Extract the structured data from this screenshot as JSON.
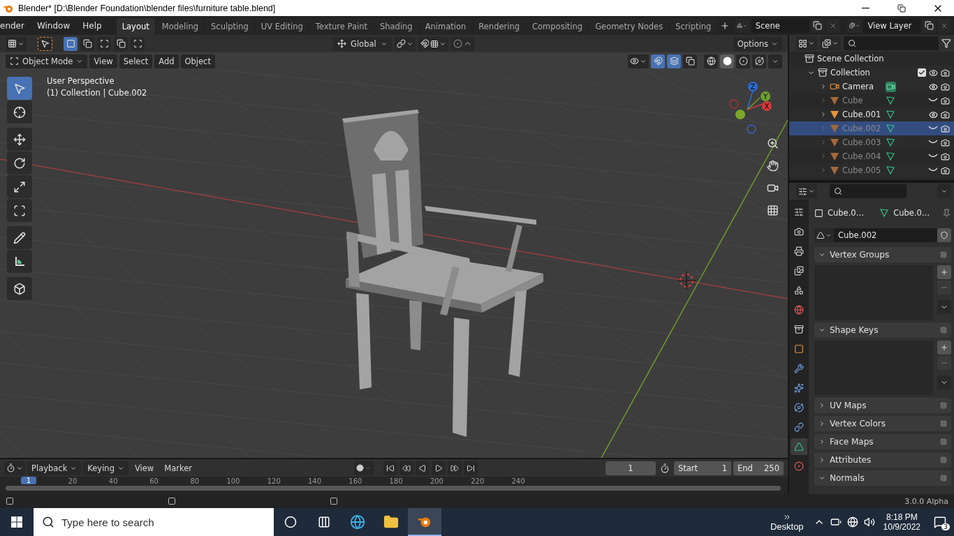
{
  "title_bar": {
    "title": "Blender* [D:\\Blender Foundation\\blender files\\furniture table.blend]"
  },
  "menu": [
    "ender",
    "Window",
    "Help"
  ],
  "workspaces": [
    {
      "label": "Layout",
      "selected": true
    },
    {
      "label": "Modeling",
      "selected": false
    },
    {
      "label": "Sculpting",
      "selected": false
    },
    {
      "label": "UV Editing",
      "selected": false
    },
    {
      "label": "Texture Paint",
      "selected": false
    },
    {
      "label": "Shading",
      "selected": false
    },
    {
      "label": "Animation",
      "selected": false
    },
    {
      "label": "Rendering",
      "selected": false
    },
    {
      "label": "Compositing",
      "selected": false
    },
    {
      "label": "Geometry Nodes",
      "selected": false
    },
    {
      "label": "Scripting",
      "selected": false
    }
  ],
  "scene": {
    "value": "Scene"
  },
  "view_layer": {
    "value": "View Layer"
  },
  "viewport": {
    "orientation": "Global",
    "options": "Options",
    "mode": "Object Mode",
    "menus": [
      "View",
      "Select",
      "Add",
      "Object"
    ],
    "perspective": "User Perspective",
    "context": "(1) Collection | Cube.002",
    "toggles": [
      {
        "kind": "gizmos",
        "on": true
      },
      {
        "kind": "overlays",
        "on": true
      },
      {
        "kind": "xray",
        "on": false
      }
    ],
    "shading": [
      {
        "kind": "wireframe",
        "selected": false
      },
      {
        "kind": "solid",
        "selected": true
      },
      {
        "kind": "material",
        "selected": false
      },
      {
        "kind": "rendered",
        "selected": false
      }
    ],
    "tools": [
      {
        "kind": "select",
        "selected": true
      },
      {
        "kind": "cursor",
        "selected": false
      },
      {
        "kind": "move",
        "selected": false
      },
      {
        "kind": "rotate",
        "selected": false
      },
      {
        "kind": "scale",
        "selected": false
      },
      {
        "kind": "transform",
        "selected": false
      },
      {
        "kind": "annotate",
        "selected": false
      },
      {
        "kind": "measure",
        "selected": false
      },
      {
        "kind": "add_cube",
        "selected": false
      }
    ],
    "axes": [
      "X",
      "Y",
      "Z"
    ]
  },
  "outliner": {
    "root": "Scene Collection",
    "collection": {
      "name": "Collection",
      "expanded": true,
      "checked": true,
      "children": [
        {
          "name": "Camera",
          "kind": "camera",
          "visible": true,
          "selected": false
        },
        {
          "name": "Cube",
          "kind": "mesh",
          "visible": false,
          "selected": false
        },
        {
          "name": "Cube.001",
          "kind": "mesh",
          "visible": true,
          "selected": false
        },
        {
          "name": "Cube.002",
          "kind": "mesh",
          "visible": false,
          "selected": true
        },
        {
          "name": "Cube.003",
          "kind": "mesh",
          "visible": false,
          "selected": false
        },
        {
          "name": "Cube.004",
          "kind": "mesh",
          "visible": false,
          "selected": false
        },
        {
          "name": "Cube.005",
          "kind": "mesh",
          "visible": false,
          "selected": false
        }
      ]
    }
  },
  "properties": {
    "tabs": [
      {
        "kind": "tool",
        "selected": false
      },
      {
        "kind": "render",
        "selected": false
      },
      {
        "kind": "output",
        "selected": false
      },
      {
        "kind": "view_layer",
        "selected": false
      },
      {
        "kind": "scene",
        "selected": false
      },
      {
        "kind": "world",
        "selected": false
      },
      {
        "kind": "collection",
        "selected": false
      },
      {
        "kind": "object",
        "selected": false
      },
      {
        "kind": "modifiers",
        "selected": false
      },
      {
        "kind": "particles",
        "selected": false
      },
      {
        "kind": "physics",
        "selected": false
      },
      {
        "kind": "constraints",
        "selected": false
      },
      {
        "kind": "data",
        "selected": true
      },
      {
        "kind": "material",
        "selected": false
      }
    ],
    "breadcrumb": [
      "Cube.0…",
      "Cube.0…"
    ],
    "data_name": "Cube.002",
    "panels": [
      {
        "title": "Vertex Groups",
        "expanded": true
      },
      {
        "title": "Shape Keys",
        "expanded": true
      },
      {
        "title": "UV Maps",
        "expanded": false
      },
      {
        "title": "Vertex Colors",
        "expanded": false
      },
      {
        "title": "Face Maps",
        "expanded": false
      },
      {
        "title": "Attributes",
        "expanded": false
      },
      {
        "title": "Normals",
        "expanded": true
      }
    ]
  },
  "timeline": {
    "menus": [
      {
        "label": "Playback",
        "kind": "dropdown"
      },
      {
        "label": "Keying",
        "kind": "dropdown"
      },
      {
        "label": "View",
        "kind": "menu"
      },
      {
        "label": "Marker",
        "kind": "menu"
      }
    ],
    "current_frame": "1",
    "start_label": "Start",
    "start": "1",
    "end_label": "End",
    "end": "250",
    "marker": "1",
    "ruler": [
      "20",
      "40",
      "60",
      "80",
      "100",
      "120",
      "140",
      "160",
      "180",
      "200",
      "220",
      "240"
    ]
  },
  "status_bar": {
    "version": "3.0.0 Alpha"
  },
  "taskbar": {
    "search_placeholder": "Type here to search",
    "desktop": "Desktop",
    "time": "8:18 PM",
    "date": "10/9/2022",
    "notifications": "3"
  }
}
